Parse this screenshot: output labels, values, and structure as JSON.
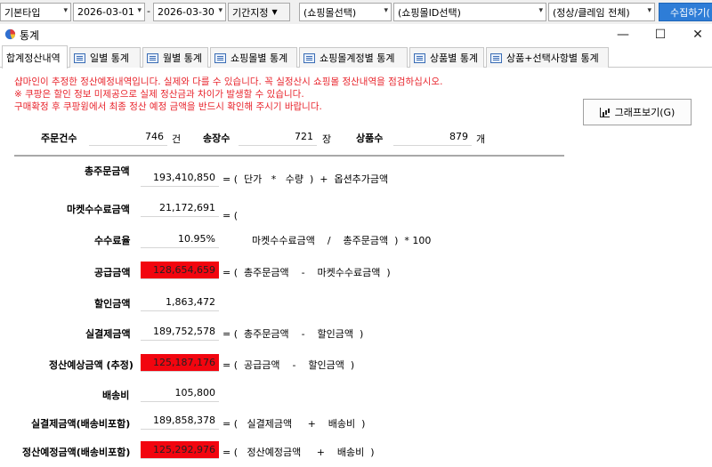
{
  "filter_bar": {
    "type_select": "기본타입",
    "date_from": "2026-03-01",
    "date_sep": "-",
    "date_to": "2026-03-30",
    "period_button": "기간지정",
    "mall_select": "(쇼핑몰선택)",
    "mall_id_select": "(쇼핑몰ID선택)",
    "status_select": "(정상/클레임 전체)",
    "collect_button": "수집하기(",
    "accent_color": "#2e7dd7"
  },
  "window": {
    "title": "통계",
    "icon": "pie-chart-icon",
    "minimize": "—",
    "maximize": "☐",
    "close": "✕"
  },
  "tabs": [
    {
      "label": "합계정산내역",
      "active": true
    },
    {
      "label": "일별 통계",
      "active": false
    },
    {
      "label": "월별 통계",
      "active": false
    },
    {
      "label": "쇼핑몰별 통계",
      "active": false
    },
    {
      "label": "쇼핑몰계정별 통계",
      "active": false
    },
    {
      "label": "상품별 통계",
      "active": false
    },
    {
      "label": "상품+선택사항별 통계",
      "active": false
    }
  ],
  "notices": [
    "샵마인이 추정한 정산예정내역입니다. 실제와 다를 수 있습니다. 꼭 실정산시 쇼핑몰 정산내역을 점검하십시오.",
    "※ 쿠팡은 할인 정보 미제공으로 실제 정산금과 차이가 발생할 수 있습니다.",
    "구매확정 후 쿠팡윙에서 최종 정산 예정 금액을 반드시 확인해 주시기 바랍니다."
  ],
  "graph_button": "그래프보기(G)",
  "counts": {
    "orders_label": "주문건수",
    "orders_value": "746",
    "orders_unit": "건",
    "invoices_label": "송장수",
    "invoices_value": "721",
    "invoices_unit": "장",
    "products_label": "상품수",
    "products_value": "879",
    "products_unit": "개"
  },
  "rows": [
    {
      "label": "총주문금액",
      "value": "193,410,850",
      "formula": "= (  단가   *   수량  )  +  옵션추가금액",
      "highlight": false
    },
    {
      "label": "마켓수수료금액",
      "value": "21,172,691",
      "formula": "= (",
      "highlight": false
    },
    {
      "label": "수수료율",
      "value": "10.95%",
      "formula": "마켓수수료금액    /    총주문금액  )  * 100",
      "highlight": false
    },
    {
      "label": "공급금액",
      "value": "128,654,659",
      "formula": "= (  총주문금액    -    마켓수수료금액  )",
      "highlight": true
    },
    {
      "label": "할인금액",
      "value": "1,863,472",
      "formula": "",
      "highlight": false
    },
    {
      "label": "실결제금액",
      "value": "189,752,578",
      "formula": "= (  총주문금액    -    할인금액  )",
      "highlight": false
    },
    {
      "label": "정산예상금액 (추정)",
      "value": "125,187,176",
      "formula": "= (  공급금액    -    할인금액  )",
      "highlight": true
    },
    {
      "label": "배송비",
      "value": "105,800",
      "formula": "",
      "highlight": false
    },
    {
      "label": "실결제금액(배송비포함)",
      "value": "189,858,378",
      "formula": "= (   실결제금액     +    배송비  )",
      "highlight": false
    },
    {
      "label": "정산예정금액(배송비포함)",
      "value": "125,292,976",
      "formula": "= (   정산예정금액     +    배송비  )",
      "highlight": true
    }
  ],
  "highlight_color": "#f2050f"
}
